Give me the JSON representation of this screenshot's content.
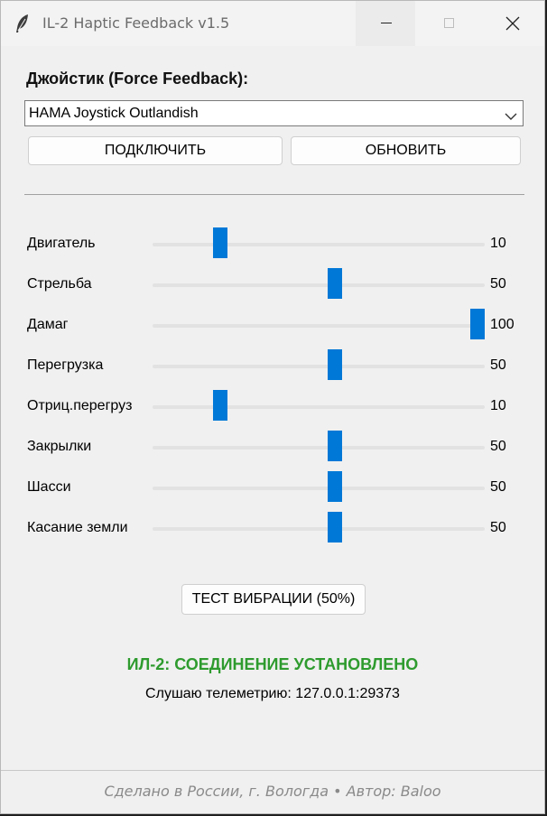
{
  "window": {
    "title": "IL-2 Haptic Feedback v1.5",
    "icon": "feather-icon"
  },
  "joystick": {
    "label": "Джойстик (Force Feedback):",
    "selected": "HAMA Joystick Outlandish",
    "connect_label": "ПОДКЛЮЧИТЬ",
    "refresh_label": "ОБНОВИТЬ"
  },
  "sliders": [
    {
      "label": "Двигатель",
      "value": "10",
      "fraction": 0.1
    },
    {
      "label": "Стрельба",
      "value": "50",
      "fraction": 0.5
    },
    {
      "label": "Дамаг",
      "value": "100",
      "fraction": 1.0
    },
    {
      "label": "Перегрузка",
      "value": "50",
      "fraction": 0.5
    },
    {
      "label": "Отриц.перегруз",
      "value": "10",
      "fraction": 0.1
    },
    {
      "label": "Закрылки",
      "value": "50",
      "fraction": 0.5
    },
    {
      "label": "Шасси",
      "value": "50",
      "fraction": 0.5
    },
    {
      "label": "Касание земли",
      "value": "50",
      "fraction": 0.5
    }
  ],
  "test_button_label": "ТЕСТ ВИБРАЦИИ (50%)",
  "status": {
    "connection": "ИЛ-2: СОЕДИНЕНИЕ УСТАНОВЛЕНО",
    "telemetry": "Слушаю телеметрию: 127.0.0.1:29373",
    "color": "#2e9b2e"
  },
  "footer": "Сделано в России, г. Вологда  •  Автор: Baloo",
  "colors": {
    "accent": "#0078d7"
  }
}
